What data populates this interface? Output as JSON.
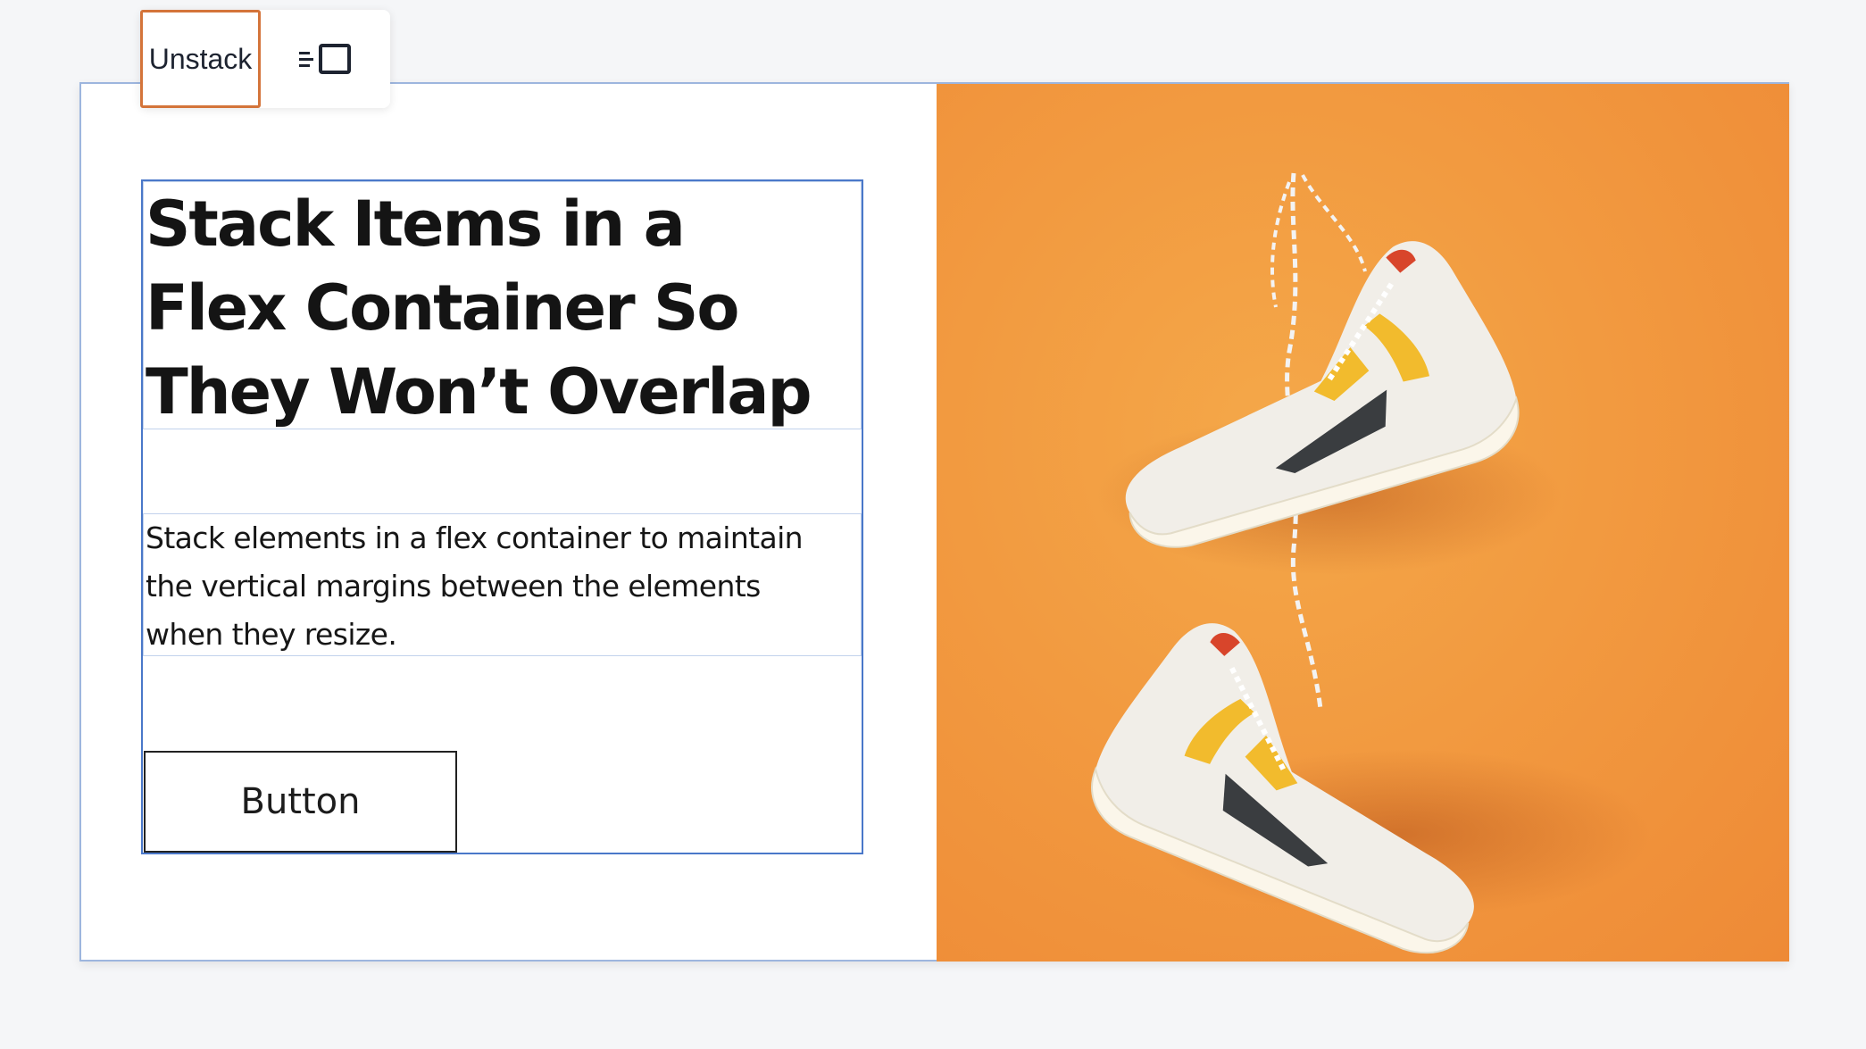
{
  "toolbar": {
    "unstack_label": "Unstack",
    "layout_icon": "layout-sidebar-icon"
  },
  "hero": {
    "heading_lines": [
      "Stack Items in a",
      "Flex Container So",
      "They Won’t Overlap"
    ],
    "paragraph_lines": [
      "Stack elements in a flex container to maintain",
      "the vertical margins between the elements",
      "when they resize."
    ],
    "button_label": "Button"
  },
  "image": {
    "subject": "sneakers-image",
    "background_color": "#f29a40"
  },
  "colors": {
    "selection_outline": "#4a78c9",
    "active_toolbar_outline": "#d4743a"
  }
}
